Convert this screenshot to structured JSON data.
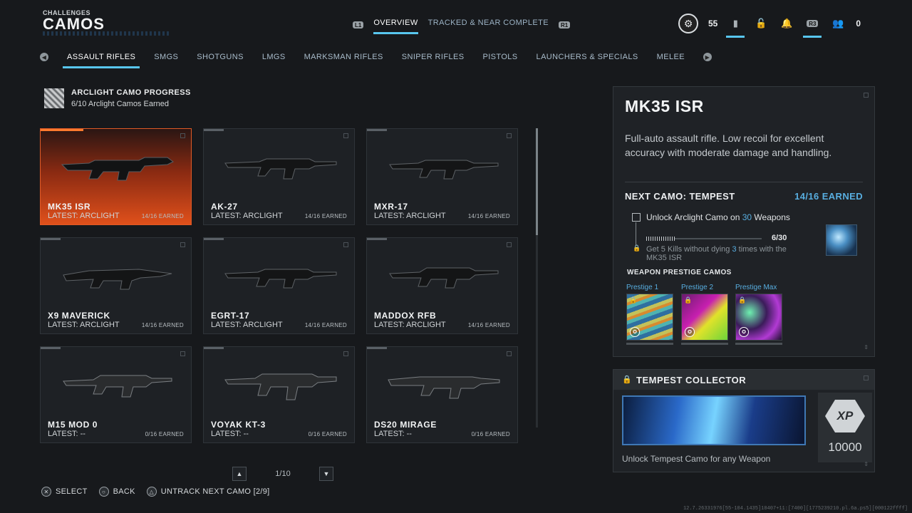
{
  "header": {
    "subtitle": "CHALLENGES",
    "title": "CAMOS",
    "left_trigger": "L1",
    "right_trigger": "R1",
    "tabs": [
      {
        "label": "OVERVIEW",
        "active": true
      },
      {
        "label": "TRACKED & NEAR COMPLETE",
        "active": false
      }
    ]
  },
  "top_right": {
    "level": "55",
    "r3_label": "R3",
    "currency": "0"
  },
  "categories": [
    {
      "label": "ASSAULT RIFLES",
      "active": true
    },
    {
      "label": "SMGS"
    },
    {
      "label": "SHOTGUNS"
    },
    {
      "label": "LMGS"
    },
    {
      "label": "MARKSMAN RIFLES"
    },
    {
      "label": "SNIPER RIFLES"
    },
    {
      "label": "PISTOLS"
    },
    {
      "label": "LAUNCHERS & SPECIALS"
    },
    {
      "label": "MELEE"
    }
  ],
  "progress": {
    "title": "ARCLIGHT CAMO PROGRESS",
    "subtitle": "6/10 Arclight Camos Earned"
  },
  "weapons": [
    {
      "name": "MK35 ISR",
      "latest": "LATEST: ARCLIGHT",
      "earned": "14/16 EARNED",
      "selected": true
    },
    {
      "name": "AK-27",
      "latest": "LATEST: ARCLIGHT",
      "earned": "14/16 EARNED"
    },
    {
      "name": "MXR-17",
      "latest": "LATEST: ARCLIGHT",
      "earned": "14/16 EARNED"
    },
    {
      "name": "X9 MAVERICK",
      "latest": "LATEST: ARCLIGHT",
      "earned": "14/16 EARNED"
    },
    {
      "name": "EGRT-17",
      "latest": "LATEST: ARCLIGHT",
      "earned": "14/16 EARNED"
    },
    {
      "name": "MADDOX RFB",
      "latest": "LATEST: ARCLIGHT",
      "earned": "14/16 EARNED"
    },
    {
      "name": "M15 MOD 0",
      "latest": "LATEST: --",
      "earned": "0/16 EARNED"
    },
    {
      "name": "VOYAK KT-3",
      "latest": "LATEST: --",
      "earned": "0/16 EARNED"
    },
    {
      "name": "DS20 MIRAGE",
      "latest": "LATEST: --",
      "earned": "0/16 EARNED"
    }
  ],
  "pager": {
    "page": "1/10"
  },
  "footer": {
    "select": "SELECT",
    "back": "BACK",
    "untrack": "UNTRACK NEXT CAMO [2/9]"
  },
  "build": "12.7.26331976[55-104.1435]10407+11:[7400][1775239210.pl.6a.ps5][000122ffff]",
  "detail": {
    "title": "MK35 ISR",
    "description": "Full-auto assault rifle. Low recoil for excellent accuracy with moderate damage and handling.",
    "next_camo": "NEXT CAMO: TEMPEST",
    "earned": "14/16 EARNED",
    "challenge1_pre": "Unlock Arclight Camo on ",
    "challenge1_num": "30",
    "challenge1_post": " Weapons",
    "progress_count": "6/30",
    "progress_fraction": 0.2,
    "challenge2_pre": "Get 5 Kills without dying ",
    "challenge2_num": "3",
    "challenge2_post": " times with the MK35 ISR",
    "prestige_title": "WEAPON PRESTIGE CAMOS",
    "prestige": [
      {
        "label": "Prestige 1"
      },
      {
        "label": "Prestige 2"
      },
      {
        "label": "Prestige Max"
      }
    ]
  },
  "collector": {
    "title": "TEMPEST COLLECTOR",
    "xp_label": "XP",
    "xp_value": "10000",
    "description": "Unlock Tempest Camo for any Weapon"
  },
  "colors": {
    "accent": "#58c6ee",
    "selected_card": "#e0501b",
    "earned_blue": "#58aee0"
  }
}
